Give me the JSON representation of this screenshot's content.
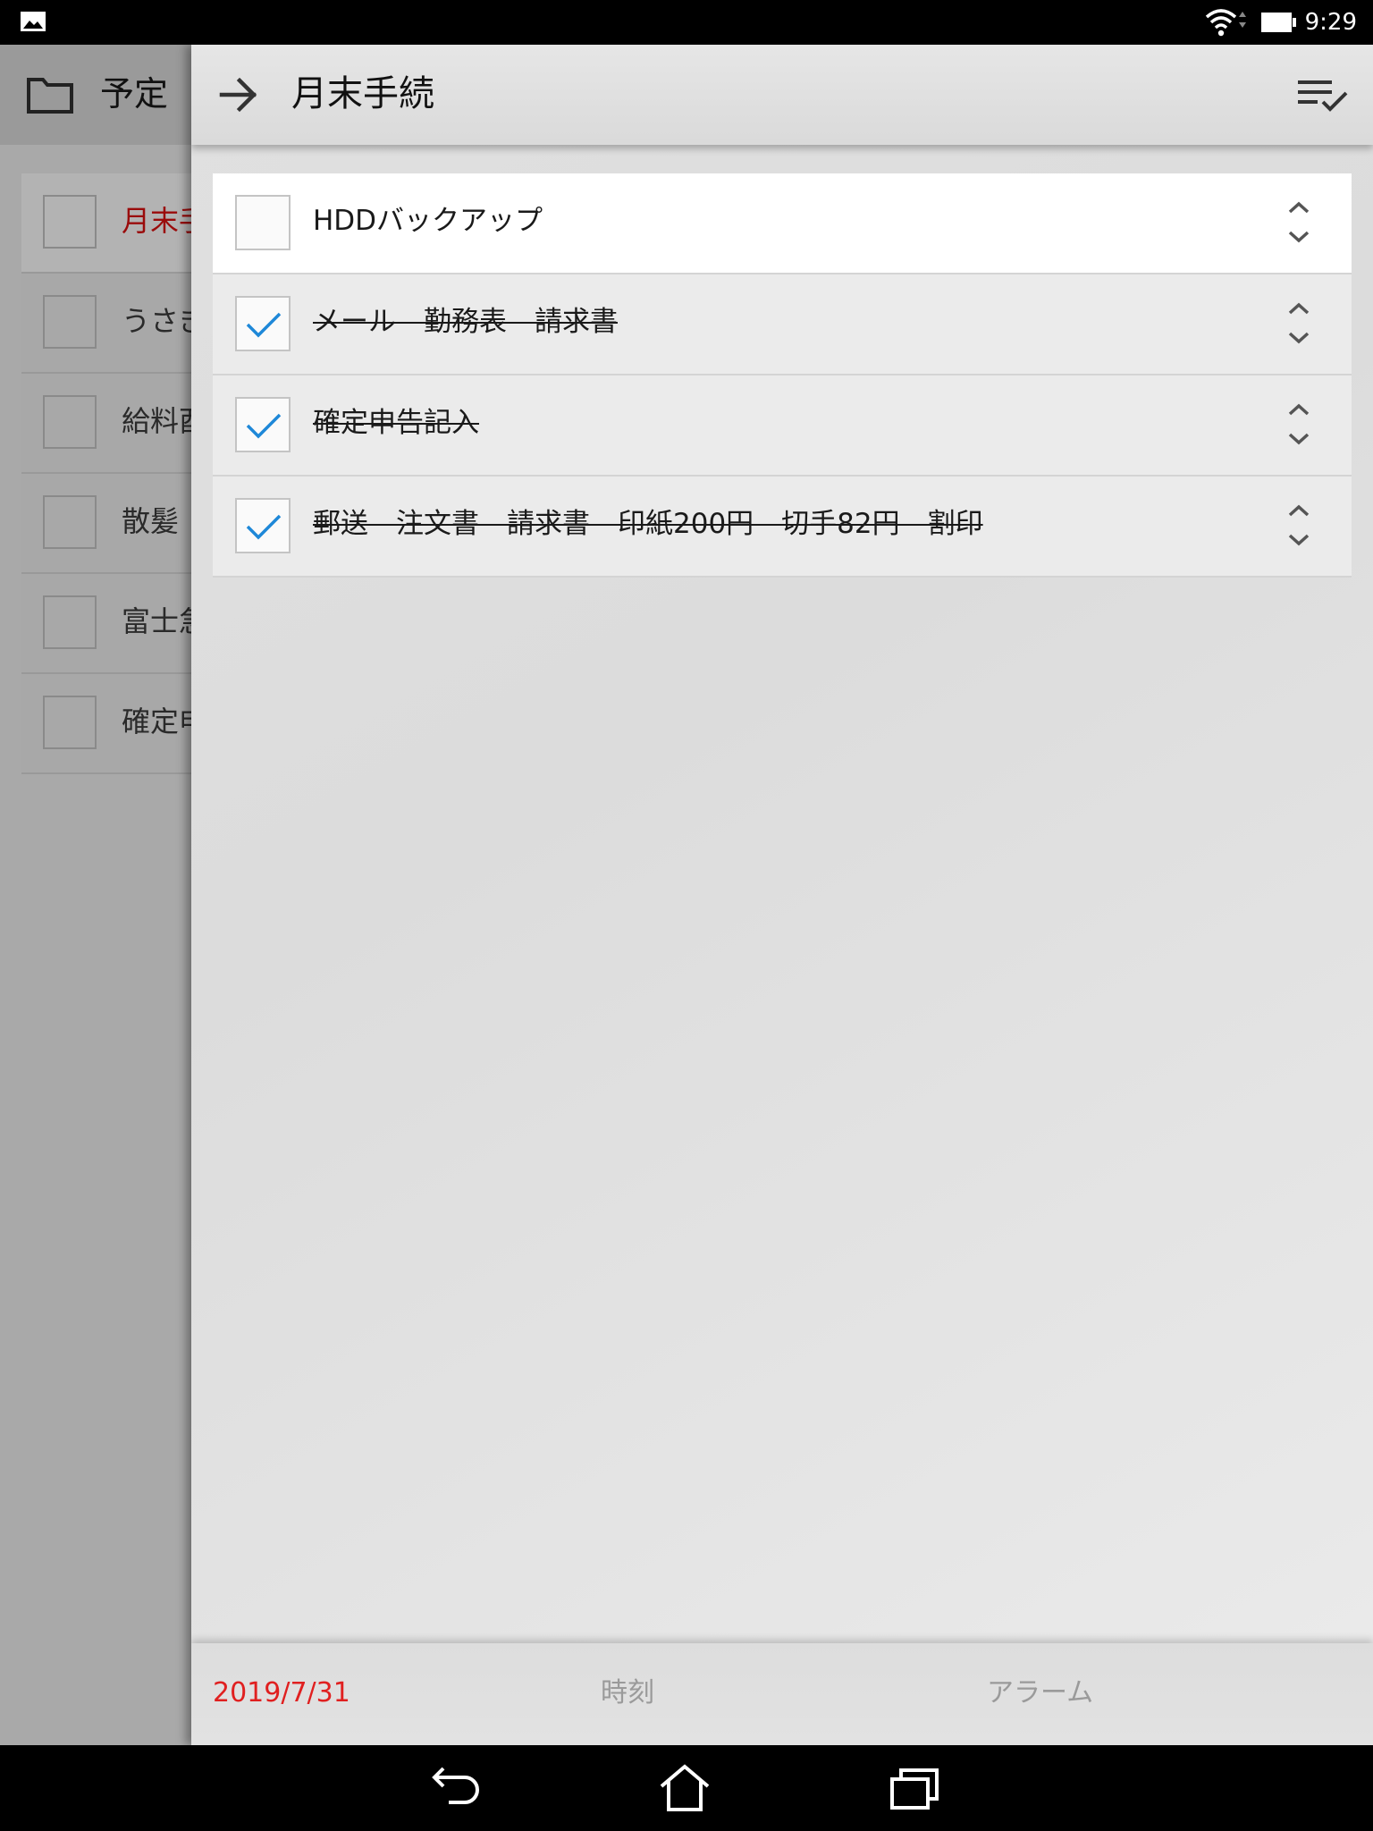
{
  "status_bar": {
    "time": "9:29"
  },
  "background_screen": {
    "title": "予定",
    "items": [
      {
        "label": "月末手",
        "active": true
      },
      {
        "label": "うさぎ",
        "active": false
      },
      {
        "label": "給料酉",
        "active": false
      },
      {
        "label": "散髪",
        "active": false
      },
      {
        "label": "富士急",
        "active": false
      },
      {
        "label": "確定申",
        "active": false
      }
    ]
  },
  "panel": {
    "title": "月末手続",
    "items": [
      {
        "text": "HDDバックアップ",
        "checked": false
      },
      {
        "text": "メール　勤務表　請求書",
        "checked": true
      },
      {
        "text": "確定申告記入",
        "checked": true
      },
      {
        "text": "郵送　注文書　請求書　印紙200円　切手82円　割印",
        "checked": true
      }
    ],
    "bottom": {
      "date": "2019/7/31",
      "time_label": "時刻",
      "alarm_label": "アラーム"
    }
  },
  "colors": {
    "check": "#1e88d8",
    "date": "#e02020",
    "active_item": "#9a0b0b"
  },
  "icons": [
    "gallery-icon",
    "wifi-icon",
    "battery-icon",
    "folder-icon",
    "arrow-right-icon",
    "check-all-icon",
    "checkmark-icon",
    "reorder-icon",
    "nav-back-icon",
    "nav-home-icon",
    "nav-recents-icon"
  ]
}
